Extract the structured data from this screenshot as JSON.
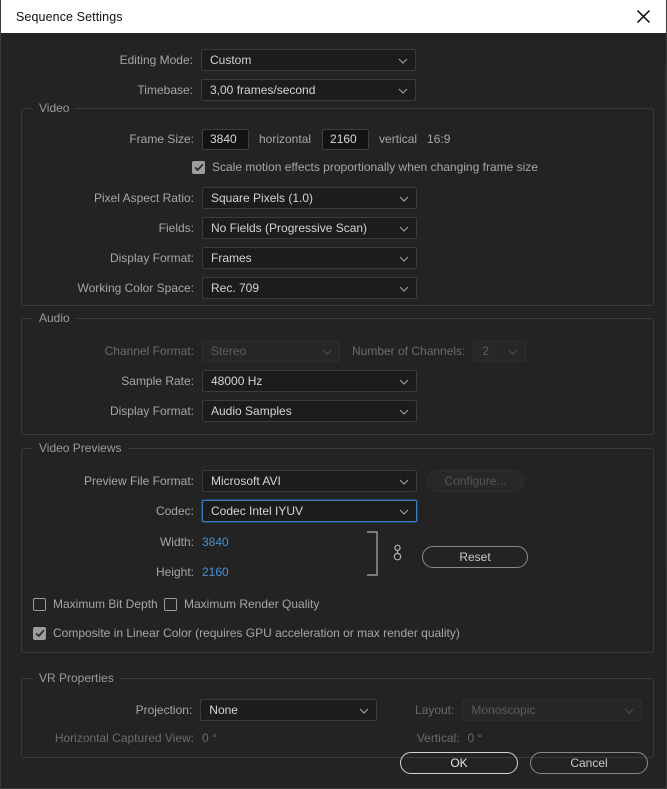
{
  "window": {
    "title": "Sequence Settings",
    "close_icon": "close-icon"
  },
  "top": {
    "editing_mode_label": "Editing Mode:",
    "editing_mode_value": "Custom",
    "timebase_label": "Timebase:",
    "timebase_value": "3,00  frames/second"
  },
  "video": {
    "group_title": "Video",
    "frame_size_label": "Frame Size:",
    "frame_width": "3840",
    "horizontal_label": "horizontal",
    "frame_height": "2160",
    "vertical_label": "vertical",
    "aspect_ratio_text": "16:9",
    "scale_motion_label": "Scale motion effects proportionally when changing frame size",
    "scale_motion_checked": true,
    "pixel_aspect_label": "Pixel Aspect Ratio:",
    "pixel_aspect_value": "Square Pixels (1.0)",
    "fields_label": "Fields:",
    "fields_value": "No Fields (Progressive Scan)",
    "display_format_label": "Display Format:",
    "display_format_value": "Frames",
    "color_space_label": "Working Color Space:",
    "color_space_value": "Rec. 709"
  },
  "audio": {
    "group_title": "Audio",
    "channel_format_label": "Channel Format:",
    "channel_format_value": "Stereo",
    "num_channels_label": "Number of Channels:",
    "num_channels_value": "2",
    "sample_rate_label": "Sample Rate:",
    "sample_rate_value": "48000 Hz",
    "display_format_label": "Display Format:",
    "display_format_value": "Audio Samples"
  },
  "video_previews": {
    "group_title": "Video Previews",
    "preview_format_label": "Preview File Format:",
    "preview_format_value": "Microsoft AVI",
    "configure_label": "Configure...",
    "codec_label": "Codec:",
    "codec_value": "Codec Intel IYUV",
    "width_label": "Width:",
    "width_value": "3840",
    "height_label": "Height:",
    "height_value": "2160",
    "reset_label": "Reset",
    "link_icon": "chain-link-icon",
    "max_bit_depth_label": "Maximum Bit Depth",
    "max_bit_depth_checked": false,
    "max_render_quality_label": "Maximum Render Quality",
    "max_render_quality_checked": false,
    "composite_linear_label": "Composite in Linear Color (requires GPU acceleration or max render quality)",
    "composite_linear_checked": true
  },
  "vr": {
    "group_title": "VR Properties",
    "projection_label": "Projection:",
    "projection_value": "None",
    "layout_label": "Layout:",
    "layout_value": "Monoscopic",
    "horizontal_captured_label": "Horizontal Captured View:",
    "horizontal_captured_value": "0 °",
    "vertical_label": "Vertical:",
    "vertical_value": "0 °"
  },
  "footer": {
    "ok_label": "OK",
    "cancel_label": "Cancel"
  },
  "colors": {
    "accent_blue": "#4b8fd4",
    "focus_blue": "#3c7cc4",
    "dialog_bg": "#232323",
    "titlebar_bg": "#ffffff"
  }
}
